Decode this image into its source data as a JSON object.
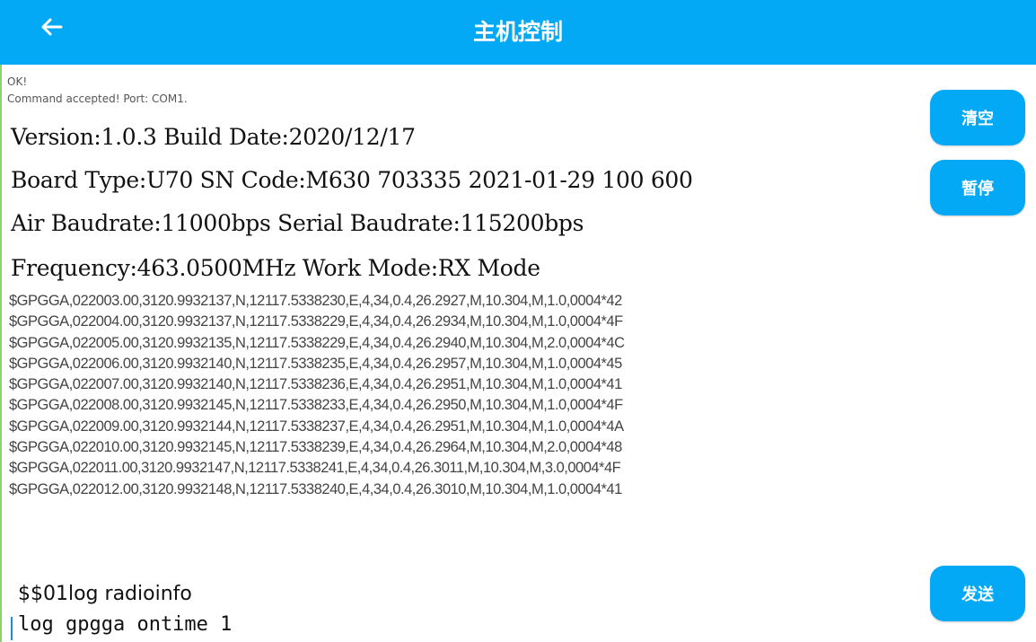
{
  "header": {
    "title": "主机控制",
    "back_icon": "arrow-left-icon"
  },
  "status": {
    "line1": "OK!",
    "line2": "Command accepted! Port: COM1."
  },
  "info": {
    "version_line": "Version:1.0.3  Build Date:2020/12/17",
    "board_line": "Board Type:U70     SN Code:M630 703335 2021-01-29 100 600",
    "baud_line": "Air Baudrate:11000bps    Serial Baudrate:115200bps",
    "freq_line": "Frequency:463.0500MHz    Work Mode:RX Mode"
  },
  "gps_lines": [
    "$GPGGA,022003.00,3120.9932137,N,12117.5338230,E,4,34,0.4,26.2927,M,10.304,M,1.0,0004*42",
    "$GPGGA,022004.00,3120.9932137,N,12117.5338229,E,4,34,0.4,26.2934,M,10.304,M,1.0,0004*4F",
    "$GPGGA,022005.00,3120.9932135,N,12117.5338229,E,4,34,0.4,26.2940,M,10.304,M,2.0,0004*4C",
    "$GPGGA,022006.00,3120.9932140,N,12117.5338235,E,4,34,0.4,26.2957,M,10.304,M,1.0,0004*45",
    "$GPGGA,022007.00,3120.9932140,N,12117.5338236,E,4,34,0.4,26.2951,M,10.304,M,1.0,0004*41",
    "$GPGGA,022008.00,3120.9932145,N,12117.5338233,E,4,34,0.4,26.2950,M,10.304,M,1.0,0004*4F",
    "$GPGGA,022009.00,3120.9932144,N,12117.5338237,E,4,34,0.4,26.2951,M,10.304,M,1.0,0004*4A",
    "$GPGGA,022010.00,3120.9932145,N,12117.5338239,E,4,34,0.4,26.2964,M,10.304,M,2.0,0004*48",
    "$GPGGA,022011.00,3120.9932147,N,12117.5338241,E,4,34,0.4,26.3011,M,10.304,M,3.0,0004*4F",
    "$GPGGA,022012.00,3120.9932148,N,12117.5338240,E,4,34,0.4,26.3010,M,10.304,M,1.0,0004*41"
  ],
  "buttons": {
    "clear": "清空",
    "pause": "暂停",
    "send": "发送"
  },
  "command_input": {
    "line1": "$$01log radioinfo",
    "line2": "log gpgga ontime 1"
  },
  "colors": {
    "accent": "#03a9f4",
    "text": "#111111",
    "log_text": "#444444"
  }
}
